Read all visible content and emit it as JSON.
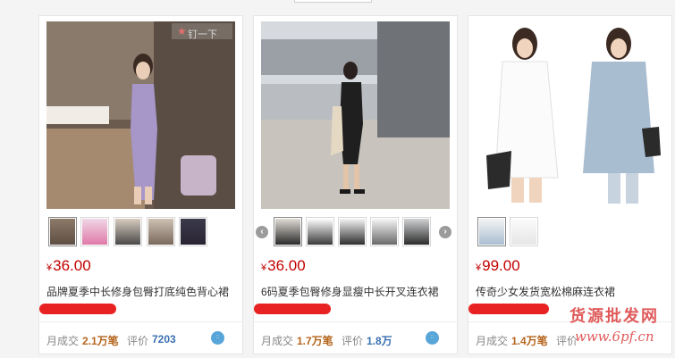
{
  "products": [
    {
      "price_currency": "¥",
      "price": "36.00",
      "title": "品牌夏季中长修身包臀打底纯色背心裙",
      "shop_name": "",
      "monthly_label": "月成交",
      "monthly_value": "2.1万笔",
      "review_label": "评价",
      "review_value": "7203",
      "image_overlay": "钉一下",
      "wangwang_icon": "chat-icon"
    },
    {
      "price_currency": "¥",
      "price": "36.00",
      "title": "6码夏季包臀修身显瘦中长开叉连衣裙",
      "shop_name": "",
      "monthly_label": "月成交",
      "monthly_value": "1.7万笔",
      "review_label": "评价",
      "review_value": "1.8万",
      "wangwang_icon": "chat-icon"
    },
    {
      "price_currency": "¥",
      "price": "99.00",
      "title": "传奇少女发货宽松棉麻连衣裙",
      "shop_name": "",
      "monthly_label": "月成交",
      "monthly_value": "1.4万笔",
      "review_label": "评价",
      "review_value": "",
      "wangwang_icon": "chat-icon"
    }
  ],
  "carousel": {
    "prev_icon": "chevron-left-icon",
    "next_icon": "chevron-right-icon"
  },
  "watermark": {
    "line1": "货源批发网",
    "line2": "www.6pf.cn"
  },
  "colors": {
    "price": "#c30000",
    "monthly": "#b5651d",
    "review": "#3a6fb0",
    "mask": "#e82222"
  }
}
